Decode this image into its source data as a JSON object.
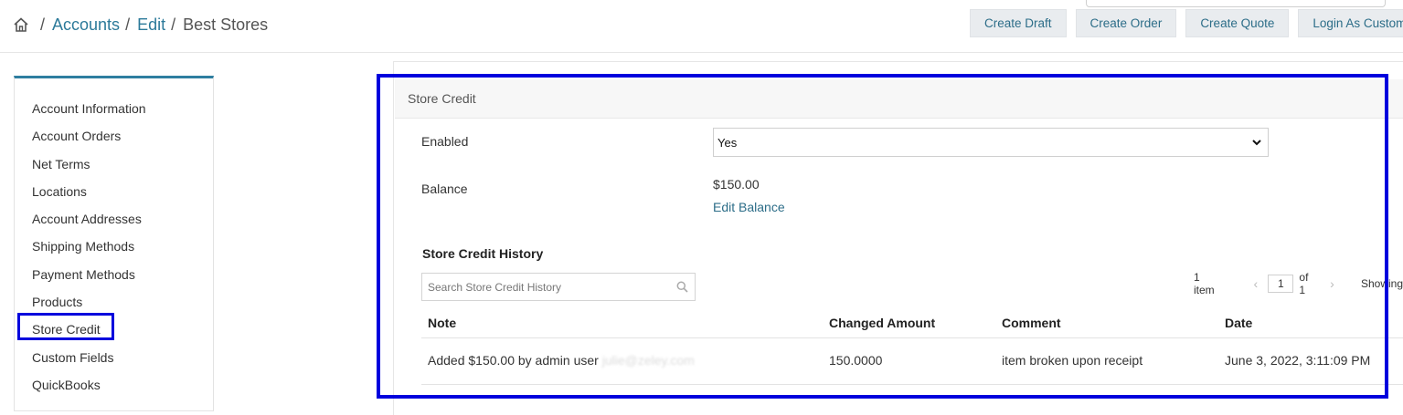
{
  "breadcrumb": {
    "home_icon": "home-icon",
    "items": [
      {
        "label": "Accounts",
        "link": true
      },
      {
        "label": "Edit",
        "link": true
      },
      {
        "label": "Best Stores",
        "link": false
      }
    ],
    "separator": "/"
  },
  "header_actions": {
    "create_draft": "Create Draft",
    "create_order": "Create Order",
    "create_quote": "Create Quote",
    "login_as_customer": "Login As Customer"
  },
  "sidebar": {
    "items": [
      {
        "label": "Account Information"
      },
      {
        "label": "Account Orders"
      },
      {
        "label": "Net Terms"
      },
      {
        "label": "Locations"
      },
      {
        "label": "Account Addresses"
      },
      {
        "label": "Shipping Methods"
      },
      {
        "label": "Payment Methods"
      },
      {
        "label": "Products"
      },
      {
        "label": "Store Credit",
        "active": true
      },
      {
        "label": "Custom Fields"
      },
      {
        "label": "QuickBooks"
      }
    ]
  },
  "store_credit": {
    "panel_title": "Store Credit",
    "enabled_label": "Enabled",
    "enabled_value": "Yes",
    "balance_label": "Balance",
    "balance_value": "$150.00",
    "edit_balance": "Edit Balance",
    "history_title": "Store Credit History",
    "search_placeholder": "Search Store Credit History",
    "pager": {
      "count": "1 item",
      "prev": "‹",
      "page": "1",
      "of": "of 1",
      "next": "›",
      "showing": "Showing"
    },
    "table": {
      "columns": [
        "Note",
        "Changed Amount",
        "Comment",
        "Date"
      ],
      "rows": [
        {
          "note": "Added $150.00 by admin user",
          "note_email": "julie@zeley.com",
          "changed_amount": "150.0000",
          "comment": "item broken upon receipt",
          "date": "June 3, 2022, 3:11:09 PM"
        }
      ]
    }
  },
  "colors": {
    "accent_link": "#2c7a9a",
    "highlight": "#0000dd",
    "sidebar_top_border": "#2e7ea0"
  }
}
